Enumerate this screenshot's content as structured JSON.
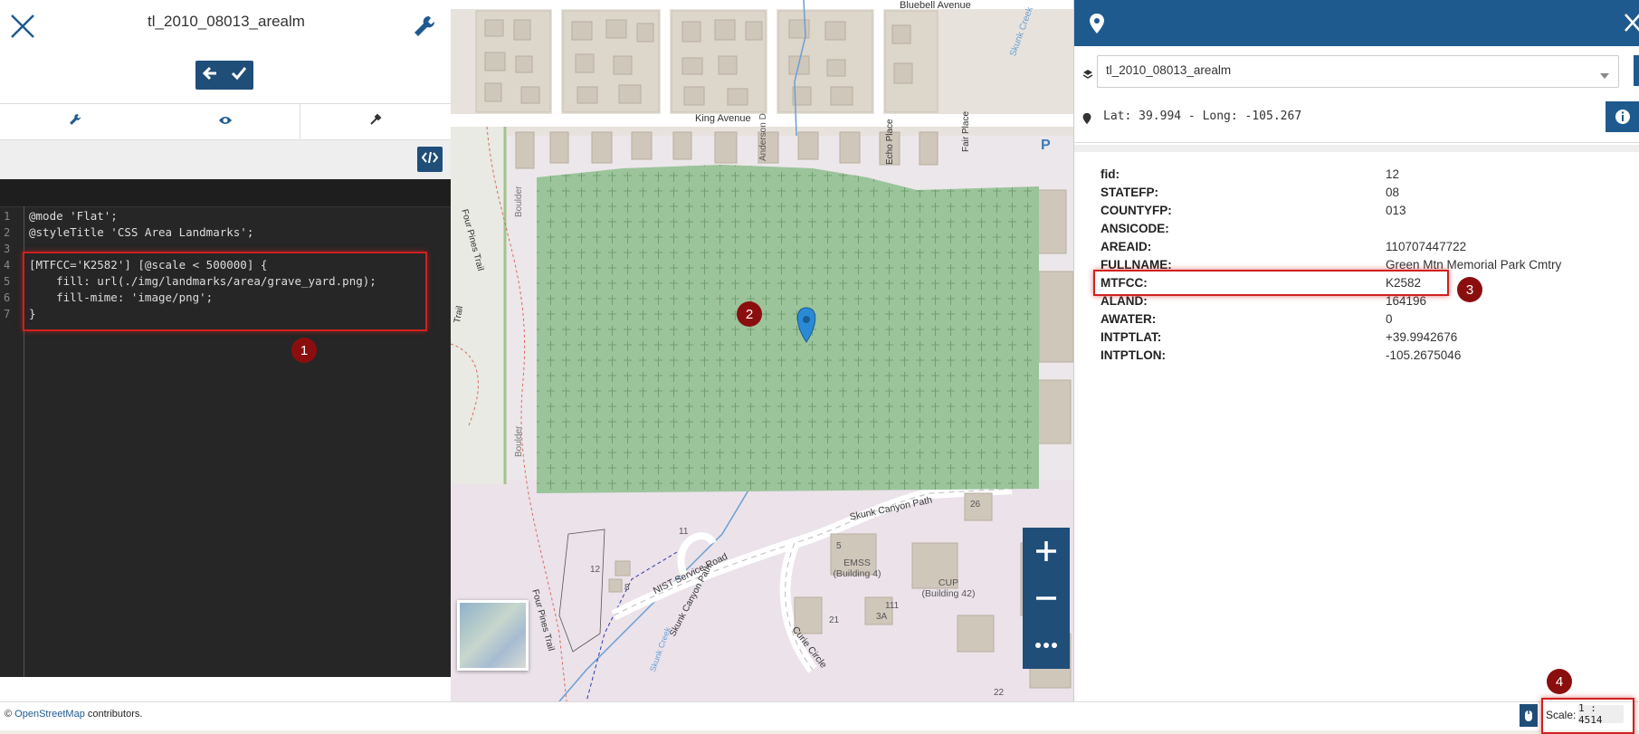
{
  "style_editor": {
    "title": "tl_2010_08013_arealm",
    "code_lines": [
      {
        "n": "1",
        "text": "@mode 'Flat';"
      },
      {
        "n": "2",
        "text": "@styleTitle 'CSS Area Landmarks';"
      },
      {
        "n": "3",
        "text": ""
      },
      {
        "n": "4",
        "text": "[MTFCC='K2582'] [@scale < 500000] {"
      },
      {
        "n": "5",
        "text": "    fill: url(./img/landmarks/area/grave_yard.png);"
      },
      {
        "n": "6",
        "text": "    fill-mime: 'image/png';"
      },
      {
        "n": "7",
        "text": "}"
      }
    ]
  },
  "map": {
    "labels": {
      "bluebell": "Bluebell Avenue",
      "king": "King Avenue",
      "four_pines_1": "Four Pines Trail",
      "four_pines_2": "Four Pines Trail",
      "boulder_1": "Boulder",
      "boulder_2": "Boulder",
      "anderson": "Anderson D",
      "echo": "Echo Place",
      "fair": "Fair Place",
      "skunk_creek": "Skunk Creek",
      "skunk_creek_2": "Skunk Creek",
      "skunk_canyon_path": "Skunk Canyon Path",
      "skunk_canyon_path_2": "Skunk Canyon Path",
      "nist": "NIST Service Road",
      "curie": "Curie Circle",
      "emss": "EMSS (Building 4)",
      "cup": "CUP (Building 42)",
      "parking": "P",
      "trail": "Trail",
      "n26": "26",
      "n5": "5",
      "n11": "11",
      "n12": "12",
      "n8": "8",
      "n21": "21",
      "n111": "111",
      "n3a": "3A",
      "n22": "22"
    }
  },
  "identify": {
    "layer": "tl_2010_08013_arealm",
    "coords": "Lat: 39.994 - Long: -105.267",
    "properties": [
      {
        "k": "fid:",
        "v": "12"
      },
      {
        "k": "STATEFP:",
        "v": "08"
      },
      {
        "k": "COUNTYFP:",
        "v": "013"
      },
      {
        "k": "ANSICODE:",
        "v": ""
      },
      {
        "k": "AREAID:",
        "v": "110707447722"
      },
      {
        "k": "FULLNAME:",
        "v": "Green Mtn Memorial Park Cmtry"
      },
      {
        "k": "MTFCC:",
        "v": "K2582"
      },
      {
        "k": "ALAND:",
        "v": "164196"
      },
      {
        "k": "AWATER:",
        "v": "0"
      },
      {
        "k": "INTPTLAT:",
        "v": "+39.9942676"
      },
      {
        "k": "INTPTLON:",
        "v": "-105.2675046"
      }
    ]
  },
  "badges": [
    "1",
    "2",
    "3",
    "4"
  ],
  "footer": {
    "copyright": "©",
    "osm_link": "OpenStreetMap",
    "contributors": "contributors.",
    "scale_label": "Scale:",
    "scale_value": "1 : 4514"
  },
  "colors": {
    "primary": "#1f4e79",
    "header": "#1f5a8f",
    "highlight": "#d02020",
    "badge": "#8b0e0e",
    "cemetery": "#9bc49b"
  }
}
